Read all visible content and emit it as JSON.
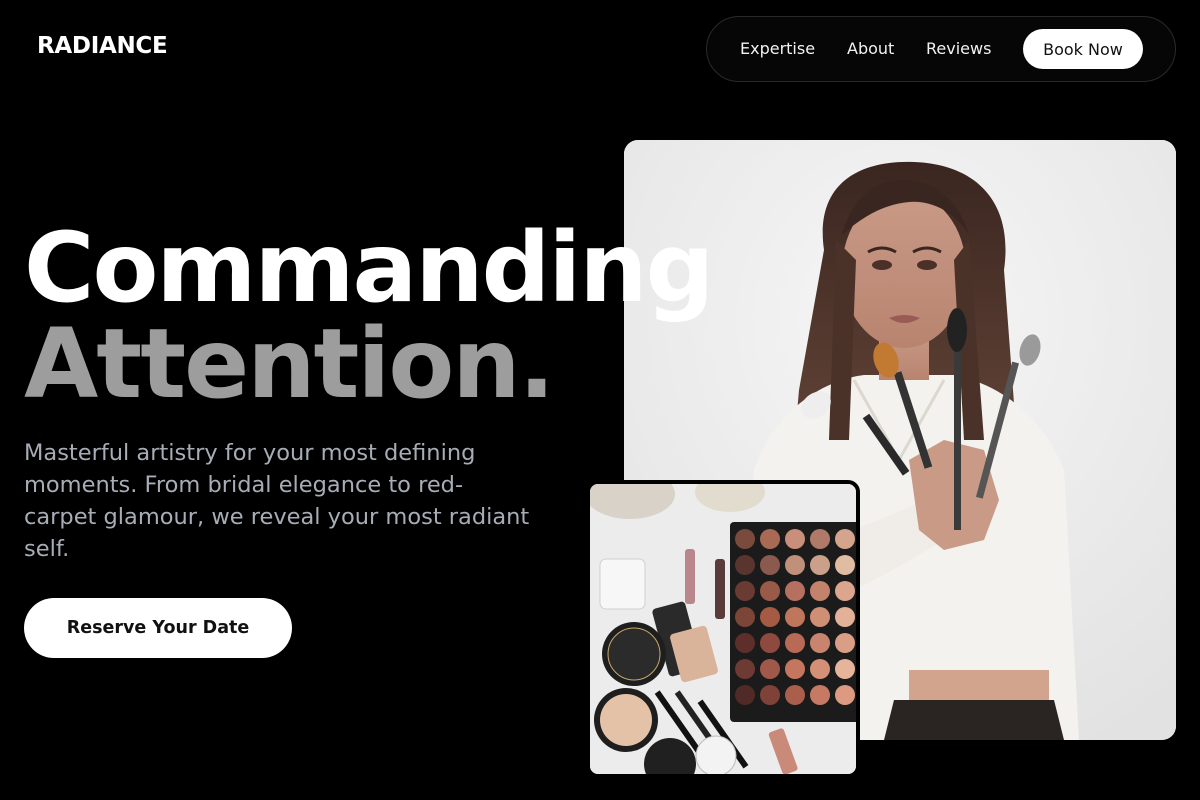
{
  "brand": {
    "logo": "RADIANCE"
  },
  "nav": {
    "items": [
      {
        "label": "Expertise"
      },
      {
        "label": "About"
      },
      {
        "label": "Reviews"
      }
    ],
    "book_label": "Book Now"
  },
  "hero": {
    "headline_line1": "Commanding",
    "headline_line2": "Attention.",
    "subtext": "Masterful artistry for your most defining moments. From bridal elegance to red-carpet glamour, we reveal your most radiant self.",
    "cta_label": "Reserve Your Date",
    "photo_description": "makeup-artist-holding-brushes-photo",
    "product_photo_description": "makeup-products-flatlay-photo"
  },
  "colors": {
    "background": "#000000",
    "headline_primary": "#ffffff",
    "headline_secondary": "#9d9d9d",
    "subtext": "#a7acb6",
    "button_bg": "#ffffff"
  }
}
